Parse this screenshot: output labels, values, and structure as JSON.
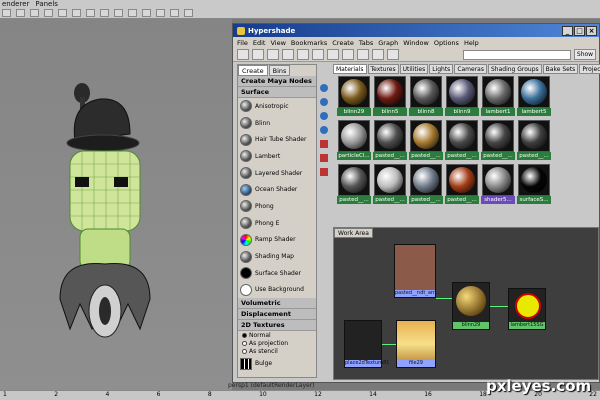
{
  "maya_menu": [
    "enderer",
    "Panels"
  ],
  "hypershade": {
    "title": "Hypershade",
    "menu": [
      "File",
      "Edit",
      "View",
      "Bookmarks",
      "Create",
      "Tabs",
      "Graph",
      "Window",
      "Options",
      "Help"
    ],
    "show_button": "Show",
    "left_tabs": [
      "Create",
      "Bins"
    ],
    "create_header": "Create Maya Nodes",
    "surface_header": "Surface",
    "surface_nodes": [
      "Anisotropic",
      "Blinn",
      "Hair Tube Shader",
      "Lambert",
      "Layered Shader",
      "Ocean Shader",
      "Phong",
      "Phong E",
      "Ramp Shader",
      "Shading Map",
      "Surface Shader",
      "Use Background"
    ],
    "volumetric_header": "Volumetric",
    "displacement_header": "Displacement",
    "textures_header": "2D Textures",
    "texture_options": [
      "Normal",
      "As projection",
      "As stencil"
    ],
    "bulge": "Bulge",
    "mat_tabs": [
      "Materials",
      "Textures",
      "Utilities",
      "Lights",
      "Cameras",
      "Shading Groups",
      "Bake Sets",
      "Projects"
    ],
    "materials": [
      {
        "label": "blinn29",
        "color": "#7a5a1c"
      },
      {
        "label": "blinn5",
        "color": "#6e1a12"
      },
      {
        "label": "blinn8",
        "color": "#585858"
      },
      {
        "label": "blinn9",
        "color": "#5a5a78"
      },
      {
        "label": "lambert1",
        "color": "#6a6a6a"
      },
      {
        "label": "lambert5",
        "color": "#3a6f9a"
      },
      {
        "label": "particleCl...",
        "color": "#9a9a9a"
      },
      {
        "label": "pasted__...",
        "color": "#4e4e4e"
      },
      {
        "label": "pasted__...",
        "color": "#a67a30"
      },
      {
        "label": "pasted__...",
        "color": "#4a4a4a"
      },
      {
        "label": "pasted__...",
        "color": "#454545"
      },
      {
        "label": "pasted__...",
        "color": "#3e3e3e"
      },
      {
        "label": "pasted__...",
        "color": "#555555"
      },
      {
        "label": "pasted__...",
        "color": "#bdbdbd"
      },
      {
        "label": "pasted__...",
        "color": "#707a8a"
      },
      {
        "label": "pasted__...",
        "color": "#a33c18"
      },
      {
        "label": "shader5...",
        "color": "#8a8a8a"
      },
      {
        "label": "surfaceS...",
        "color": "#050505"
      }
    ],
    "work_tab": "Work Area",
    "work_nodes": {
      "tex_top": "pasted__ndt_arn...",
      "blinn": "blinn29",
      "sg": "lambert15SG",
      "place": "place2dTexture81",
      "file": "file29"
    }
  },
  "viewport_status": "persp1 (defaultRenderLayer)",
  "ruler_ticks": [
    "1",
    "2",
    "4",
    "6",
    "8",
    "10",
    "12",
    "14",
    "16",
    "18",
    "20",
    "22"
  ],
  "watermark": "pxleyes.com"
}
